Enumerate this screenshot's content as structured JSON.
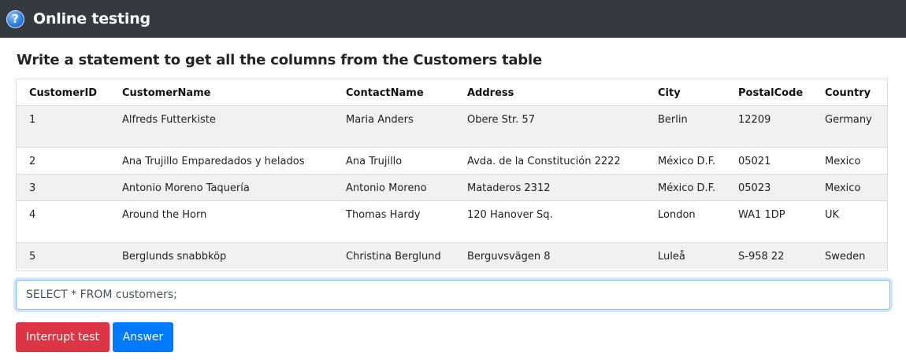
{
  "app": {
    "title": "Online testing"
  },
  "question": {
    "text": "Write a statement to get all the columns from the Customers table"
  },
  "table": {
    "columns": [
      "CustomerID",
      "CustomerName",
      "ContactName",
      "Address",
      "City",
      "PostalCode",
      "Country"
    ],
    "rows": [
      [
        "1",
        "Alfreds Futterkiste",
        "Maria Anders",
        "Obere Str. 57",
        "Berlin",
        "12209",
        "Germany"
      ],
      [
        "2",
        "Ana Trujillo Emparedados y helados",
        "Ana Trujillo",
        "Avda. de la Constitución 2222",
        "México D.F.",
        "05021",
        "Mexico"
      ],
      [
        "3",
        "Antonio Moreno Taquería",
        "Antonio Moreno",
        "Mataderos 2312",
        "México D.F.",
        "05023",
        "Mexico"
      ],
      [
        "4",
        "Around the Horn",
        "Thomas Hardy",
        "120 Hanover Sq.",
        "London",
        "WA1 1DP",
        "UK"
      ],
      [
        "5",
        "Berglunds snabbköp",
        "Christina Berglund",
        "Berguvsvägen 8",
        "Luleå",
        "S-958 22",
        "Sweden"
      ]
    ]
  },
  "query": {
    "value": "SELECT * FROM customers;"
  },
  "buttons": {
    "interrupt": "Interrupt test",
    "answer": "Answer"
  },
  "icons": {
    "app": "help-icon"
  },
  "colors": {
    "topbar": "#343a40",
    "danger": "#dc3545",
    "primary": "#007bff",
    "focus": "#80bdff"
  }
}
